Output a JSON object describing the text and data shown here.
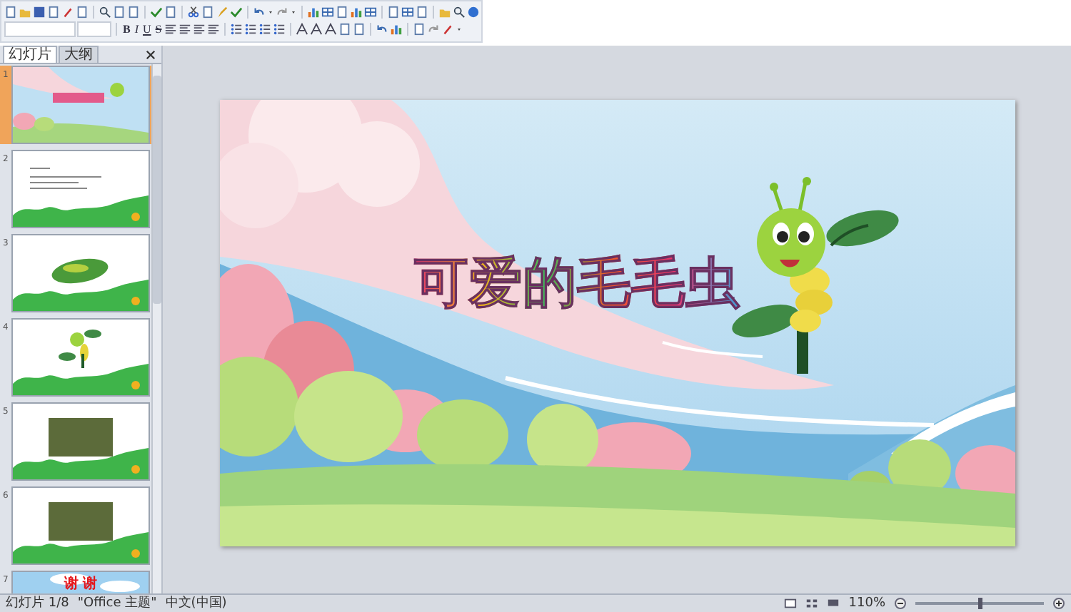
{
  "toolbar": {
    "format_buttons": [
      "B",
      "I",
      "U",
      "S"
    ]
  },
  "slide_panel": {
    "tabs": [
      {
        "label": "幻灯片",
        "selected": true
      },
      {
        "label": "大纲",
        "selected": false
      }
    ],
    "thumbnails": [
      {
        "number": "1",
        "kind": "title",
        "selected": true
      },
      {
        "number": "2",
        "kind": "text",
        "selected": false
      },
      {
        "number": "3",
        "kind": "leaf",
        "selected": false
      },
      {
        "number": "4",
        "kind": "caterpillar",
        "selected": false
      },
      {
        "number": "5",
        "kind": "photo",
        "selected": false
      },
      {
        "number": "6",
        "kind": "photo",
        "selected": false
      },
      {
        "number": "7",
        "kind": "thanks",
        "selected": false,
        "text": "谢 谢"
      }
    ]
  },
  "slide": {
    "title": "可爱的毛毛虫"
  },
  "status_bar": {
    "slide_number": "幻灯片 1/8",
    "theme": "\"Office 主题\"",
    "language": "中文(中国)",
    "zoom": "110%",
    "level": 0.5
  }
}
